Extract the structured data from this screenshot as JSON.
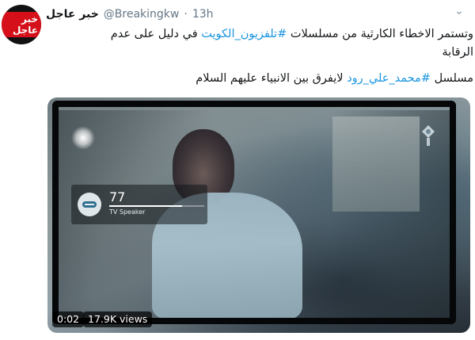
{
  "account": {
    "display_name": "خبر عاجل",
    "handle": "@Breakingkw",
    "separator": "·",
    "time": "13h",
    "avatar_text": "خبر عاجل"
  },
  "tweet": {
    "line1_part1": "وتستمر الاخطاء الكارثية من مسلسلات ",
    "hashtag1": "#تلفزيون_الكويت",
    "line1_part2": " في دليل على عدم الرقابة",
    "line2_part1": "مسلسل ",
    "hashtag2": "#محمد_علي_رود",
    "line2_part2": " لايفرق بين الانبياء عليهم السلام"
  },
  "video": {
    "volume_value": "77",
    "volume_level": 0.77,
    "volume_label": "TV Speaker",
    "elapsed": "0:02",
    "views": "17.9K views"
  },
  "icons": {
    "chevron": "chevron-down-icon",
    "speaker": "speaker-icon",
    "logo": "tv-channel-logo-icon"
  },
  "colors": {
    "link": "#1b95e0",
    "muted": "#657786",
    "badge": "#d6101a"
  }
}
